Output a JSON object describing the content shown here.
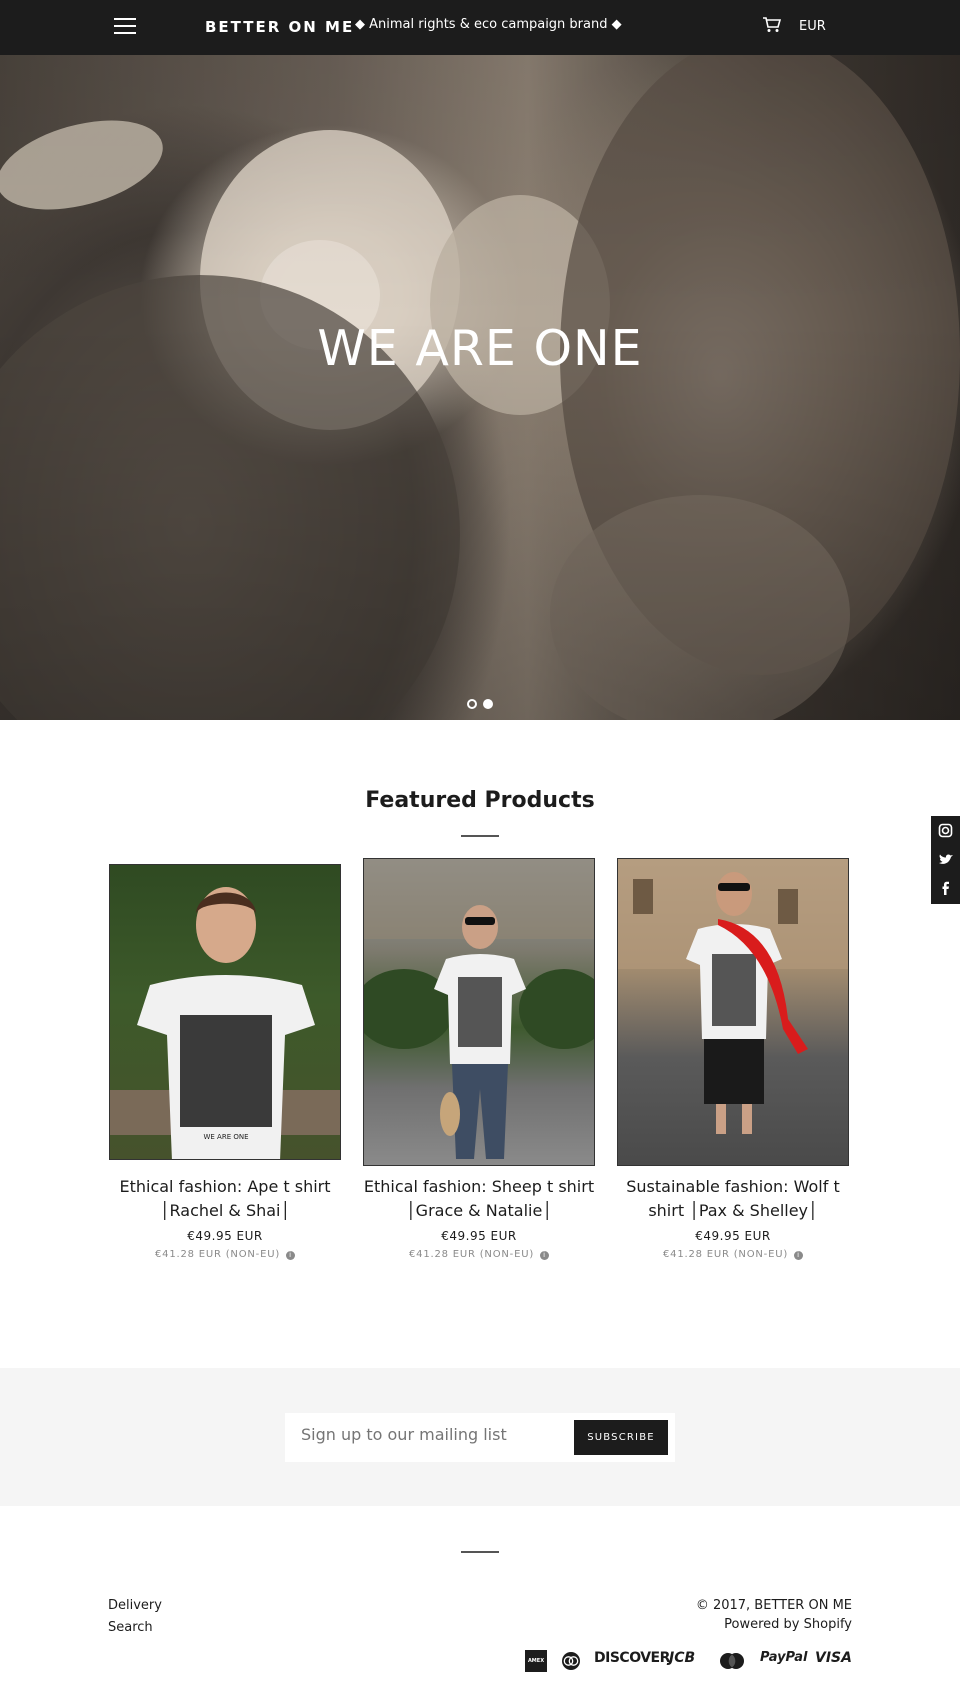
{
  "header": {
    "logo": "BETTER ON ME",
    "tagline": "◆ Animal rights & eco campaign brand ◆",
    "currency": "EUR"
  },
  "hero": {
    "title": "WE ARE ONE",
    "slides_total": 2,
    "active_slide": 2
  },
  "featured": {
    "title": "Featured Products",
    "products": [
      {
        "name_line1": "Ethical fashion: Ape t shirt",
        "name_line2": "│Rachel & Shai│",
        "price": "€49.95 EUR",
        "price_non_eu": "€41.28 EUR (NON-EU)"
      },
      {
        "name_line1": "Ethical fashion: Sheep t shirt",
        "name_line2": "│Grace & Natalie│",
        "price": "€49.95 EUR",
        "price_non_eu": "€41.28 EUR (NON-EU)"
      },
      {
        "name_line1": "Sustainable fashion: Wolf t",
        "name_line2": "shirt │Pax & Shelley│",
        "price": "€49.95 EUR",
        "price_non_eu": "€41.28 EUR (NON-EU)"
      }
    ]
  },
  "mailing": {
    "placeholder": "Sign up to our mailing list",
    "button": "SUBSCRIBE"
  },
  "footer": {
    "links": [
      "Delivery",
      "Search"
    ],
    "copyright": "© 2017, BETTER ON ME",
    "powered": "Powered by Shopify",
    "payments": [
      "AMEX",
      "diners-club",
      "DISCOVER",
      "JCB",
      "MasterCard",
      "PayPal",
      "VISA"
    ]
  },
  "social": [
    "instagram-icon",
    "twitter-icon",
    "facebook-icon"
  ]
}
